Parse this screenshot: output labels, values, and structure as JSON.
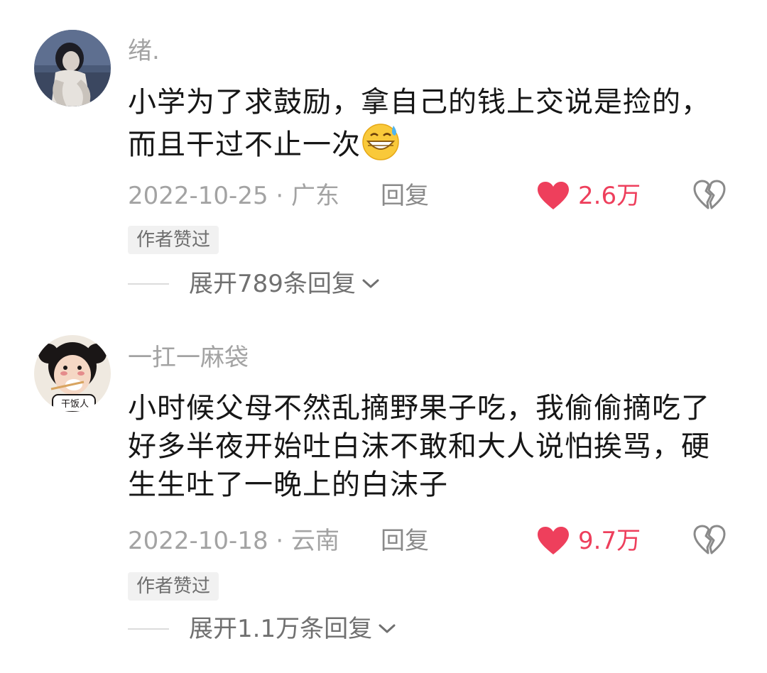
{
  "comments": [
    {
      "username": "绪.",
      "content": "小学为了求鼓励，拿自己的钱上交说是捡的，而且干过不止一次",
      "emoji_icon": "grinning-sweat-emoji",
      "meta": "2022-10-25 · 广东",
      "reply_label": "回复",
      "like_count": "2.6万",
      "badge": "作者赞过",
      "expand_label": "展开789条回复"
    },
    {
      "username": "一扛一麻袋",
      "content": "小时候父母不然乱摘野果子吃，我偷偷摘吃了好多半夜开始吐白沫不敢和大人说怕挨骂，硬生生吐了一晚上的白沫子",
      "meta": "2022-10-18 · 云南",
      "reply_label": "回复",
      "like_count": "9.7万",
      "badge": "作者赞过",
      "expand_label": "展开1.1万条回复",
      "avatar_caption": "干饭人"
    }
  ],
  "colors": {
    "like": "#ee3f5c",
    "muted": "#a3a3a3",
    "text": "#161616"
  }
}
